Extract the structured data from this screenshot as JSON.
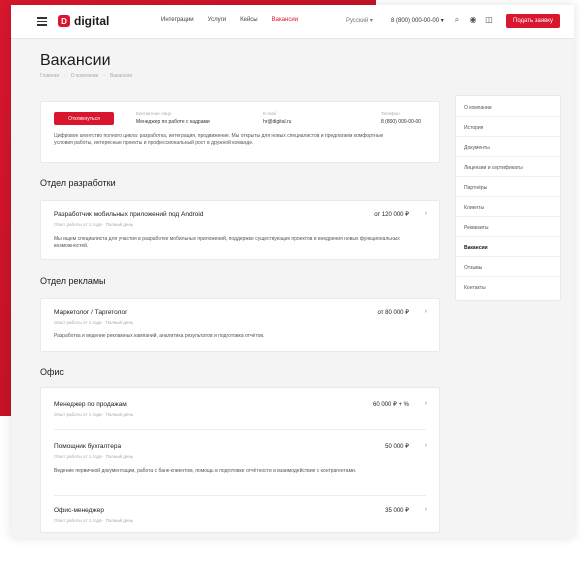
{
  "header": {
    "logo_mark": "D",
    "logo_text": "digital",
    "nav": [
      "Интеграции",
      "Услуги",
      "Кейсы",
      "Вакансии"
    ],
    "lang": "Русский ▾",
    "phone": "8 (800) 000-00-00 ▾",
    "cta": "Подать заявку"
  },
  "page": {
    "title": "Вакансии",
    "breadcrumbs": [
      "Главная",
      "О компании",
      "Вакансии"
    ]
  },
  "info": {
    "button": "Откликнуться",
    "cols": [
      {
        "label": "Контактное лицо",
        "value": "Менеджер по работе с кадрами"
      },
      {
        "label": "E-mail",
        "value": "hr@digital.ru"
      },
      {
        "label": "Телефон",
        "value": "8 (800) 000-00-00"
      }
    ],
    "text": "Цифровое агентство полного цикла: разработка, интеграция, продвижение. Мы открыты для новых специалистов и предлагаем комфортные условия работы, интересные проекты и профессиональный рост в дружной команде."
  },
  "sections": [
    {
      "title": "Отдел разработки",
      "jobs": [
        {
          "title": "Разработчик мобильных приложений под Android",
          "meta": [
            "Опыт работы от 1 года",
            "Полный день"
          ],
          "salary": "от 120 000 ₽",
          "desc": "Мы ищем специалиста для участия в разработке мобильных приложений, поддержке существующих проектов и внедрения новых функциональных возможностей."
        }
      ]
    },
    {
      "title": "Отдел рекламы",
      "jobs": [
        {
          "title": "Маркетолог / Таргетолог",
          "meta": [
            "Опыт работы от 1 года",
            "Полный день"
          ],
          "salary": "от 80 000 ₽",
          "desc": "Разработка и ведение рекламных кампаний, аналитика результатов и подготовка отчётов."
        }
      ]
    },
    {
      "title": "Офис",
      "jobs": [
        {
          "title": "Менеджер по продажам",
          "meta": [
            "Опыт работы от 1 года",
            "Полный день"
          ],
          "salary": "60 000 ₽ + %",
          "desc": ""
        },
        {
          "title": "Помощник бухгалтера",
          "meta": [
            "Опыт работы от 1 года",
            "Полный день"
          ],
          "salary": "50 000 ₽",
          "desc": "Ведение первичной документации, работа с банк-клиентом, помощь в подготовке отчётности и взаимодействие с контрагентами."
        },
        {
          "title": "Офис-менеджер",
          "meta": [
            "Опыт работы от 1 года",
            "Полный день"
          ],
          "salary": "35 000 ₽",
          "desc": ""
        }
      ]
    }
  ],
  "sidebar": {
    "items": [
      "О компании",
      "История",
      "Документы",
      "Лицензии и сертификаты",
      "Партнёры",
      "Клиенты",
      "Реквизиты",
      "Вакансии",
      "Отзывы",
      "Контакты"
    ],
    "active_index": 7
  },
  "colors": {
    "accent": "#d8162e",
    "background": "#f4f4f5"
  }
}
